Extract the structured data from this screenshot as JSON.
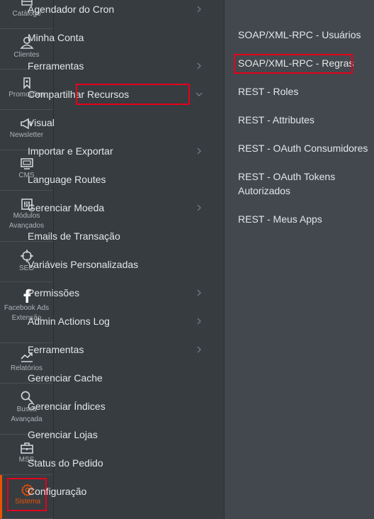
{
  "sidebar": {
    "items": [
      {
        "label": "Catálogo",
        "icon": "catalog-icon"
      },
      {
        "label": "Clientes",
        "icon": "customers-icon"
      },
      {
        "label": "Promoções",
        "icon": "promotions-icon"
      },
      {
        "label": "Newsletter",
        "icon": "newsletter-icon"
      },
      {
        "label": "CMS",
        "icon": "cms-icon"
      },
      {
        "label": "Módulos Avançados",
        "icon": "modules-icon"
      },
      {
        "label": "SEO",
        "icon": "seo-icon"
      },
      {
        "label": "Facebook Ads Extensão",
        "icon": "facebook-icon"
      },
      {
        "label": "Relatórios",
        "icon": "reports-icon"
      },
      {
        "label": "Busca Avançada",
        "icon": "search-icon"
      },
      {
        "label": "MSS",
        "icon": "mss-icon"
      },
      {
        "label": "Sistema",
        "icon": "gear-icon"
      }
    ]
  },
  "submenu": {
    "items": [
      {
        "label": "Agendador do Cron"
      },
      {
        "label": "Minha Conta"
      },
      {
        "label": "Ferramentas"
      },
      {
        "label": "Compartilhar Recursos"
      },
      {
        "label": "Visual"
      },
      {
        "label": "Importar e Exportar"
      },
      {
        "label": "Language Routes"
      },
      {
        "label": "Gerenciar Moeda"
      },
      {
        "label": "Emails de Transação"
      },
      {
        "label": "Variáveis Personalizadas"
      },
      {
        "label": "Permissões"
      },
      {
        "label": "Admin Actions Log"
      },
      {
        "label": "Ferramentas"
      },
      {
        "label": "Gerenciar Cache"
      },
      {
        "label": "Gerenciar Índices"
      },
      {
        "label": "Gerenciar Lojas"
      },
      {
        "label": "Status do Pedido"
      },
      {
        "label": "Configuração"
      }
    ]
  },
  "subsubmenu": {
    "items": [
      {
        "label": "SOAP/XML-RPC - Usuários"
      },
      {
        "label": "SOAP/XML-RPC - Regras"
      },
      {
        "label": "REST - Roles"
      },
      {
        "label": "REST - Attributes"
      },
      {
        "label": "REST - OAuth Consumidores"
      },
      {
        "label": "REST - OAuth Tokens Autorizados"
      },
      {
        "label": "REST - Meus Apps"
      }
    ]
  },
  "colors": {
    "background": "#373c41",
    "panel": "#43484e",
    "text": "#e4e6e8",
    "highlight": "#e3001b",
    "active_accent": "#eb5202"
  }
}
